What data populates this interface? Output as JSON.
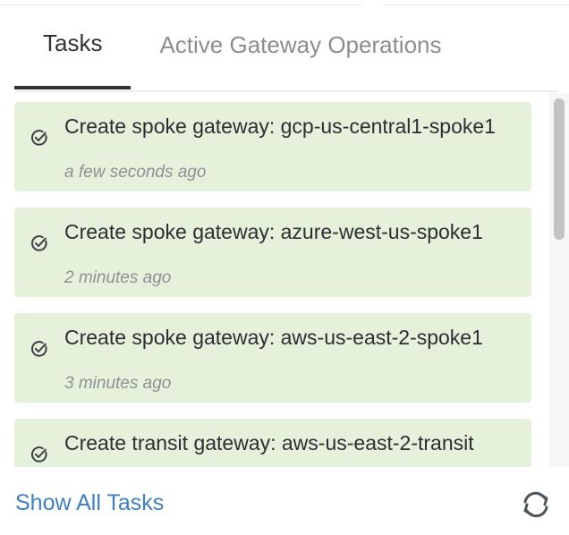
{
  "tabs": [
    {
      "label": "Tasks",
      "active": true
    },
    {
      "label": "Active Gateway Operations",
      "active": false
    }
  ],
  "tasks": [
    {
      "title": "Create spoke gateway: gcp-us-central1-spoke1",
      "time": "a few seconds ago",
      "status_icon": "check-circle-icon"
    },
    {
      "title": "Create spoke gateway: azure-west-us-spoke1",
      "time": "2 minutes ago",
      "status_icon": "check-circle-icon"
    },
    {
      "title": "Create spoke gateway: aws-us-east-2-spoke1",
      "time": "3 minutes ago",
      "status_icon": "check-circle-icon"
    },
    {
      "title": "Create transit gateway: aws-us-east-2-transit",
      "time": "",
      "status_icon": "check-circle-icon"
    }
  ],
  "footer": {
    "show_all_label": "Show All Tasks",
    "refresh_icon": "refresh-icon"
  },
  "colors": {
    "task_bg": "#e5f1da",
    "link": "#3f7fc2",
    "active_tab": "#2f3338",
    "inactive_tab": "#8a8d91"
  }
}
